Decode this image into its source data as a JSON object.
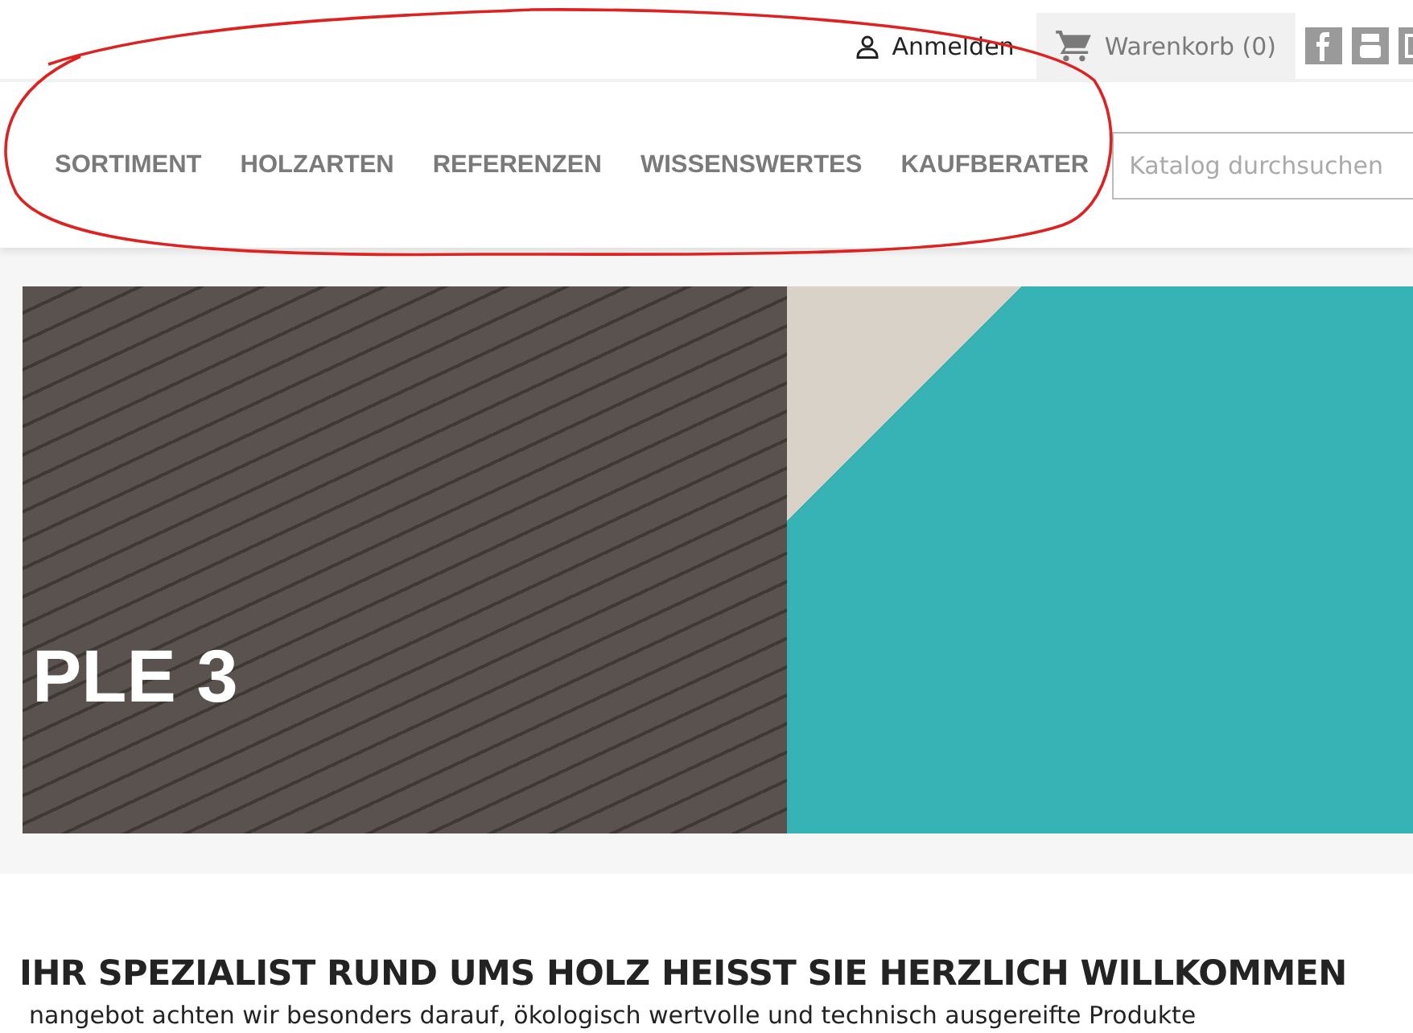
{
  "header": {
    "login": "Anmelden",
    "cart": "Warenkorb (0)"
  },
  "nav": {
    "items": [
      "SORTIMENT",
      "HOLZARTEN",
      "REFERENZEN",
      "WISSENSWERTES",
      "KAUFBERATER"
    ],
    "search": {
      "placeholder": "Katalog durchsuchen"
    }
  },
  "slider": {
    "caption": "PLE 3"
  },
  "welcome": {
    "heading": "IHR SPEZIALIST RUND UMS HOLZ HEISST SIE HERZLICH WILLKOMMEN",
    "text": "nangebot achten wir besonders darauf, ökologisch wertvolle und technisch ausgereifte Produkte"
  }
}
